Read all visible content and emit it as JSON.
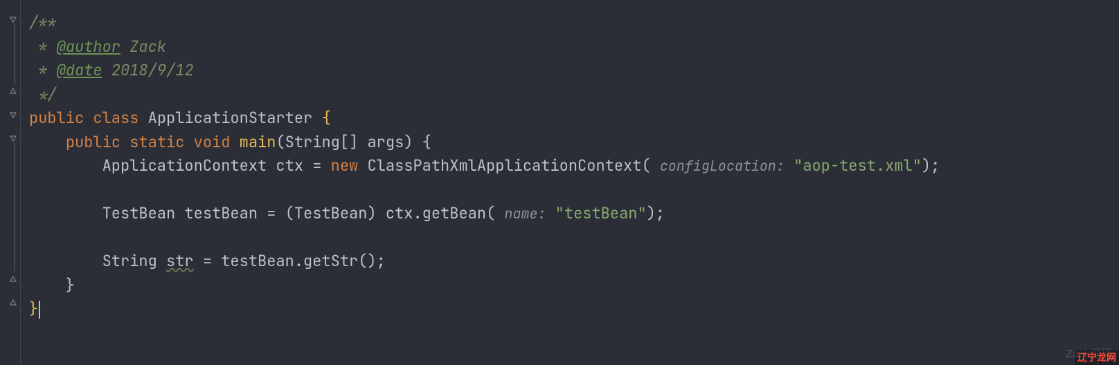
{
  "file": {
    "comment": {
      "open": "/**",
      "authorTag": "@author",
      "authorValue": "Zack",
      "dateTag": "@date",
      "dateValue": "2018/9/12",
      "close": "*/"
    },
    "keywords": {
      "public": "public",
      "class": "class",
      "static": "static",
      "void": "void",
      "new": "new"
    },
    "className": "ApplicationStarter",
    "method": {
      "name": "main",
      "paramType": "String[]",
      "paramName": "args"
    },
    "body": {
      "ctxType": "ApplicationContext",
      "ctxVar": "ctx",
      "ctxCtor": "ClassPathXmlApplicationContext",
      "ctxHint": "configLocation:",
      "ctxArg": "\"aop-test.xml\"",
      "beanType": "TestBean",
      "beanVar": "testBean",
      "beanCast": "TestBean",
      "beanCall": "ctx.getBean",
      "beanHint": "name:",
      "beanArg": "\"testBean\"",
      "strType": "String",
      "strVar": "str",
      "strExpr": "testBean.getStr()"
    }
  },
  "watermark": "Zack说码",
  "corner": "辽宁龙网"
}
